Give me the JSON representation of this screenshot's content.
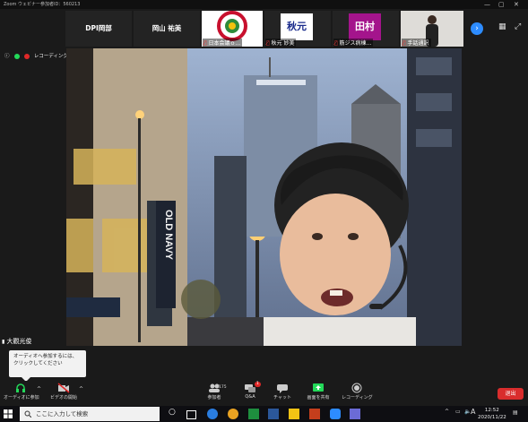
{
  "window": {
    "title": "Zoom ウェビナー参加者ID：560213"
  },
  "participants": [
    {
      "name": "DPI岡部",
      "caption": ""
    },
    {
      "name": "岡山 祐美",
      "caption": ""
    },
    {
      "name": "",
      "caption": "日本会議ｏ..."
    },
    {
      "name": "秋元",
      "caption": "秋元 妙美"
    },
    {
      "name": "田村",
      "caption": "筋ジス病棟..."
    },
    {
      "name": "",
      "caption": "手話通訳"
    }
  ],
  "recording": {
    "label": "レコーディングしています"
  },
  "speaker": {
    "name": "大觀光俊"
  },
  "audio_popup": {
    "text": "オーディオへ参加するには、クリックしてください"
  },
  "toolbar": {
    "audio": "オーディオに参加",
    "video": "ビデオの開始",
    "participants": "参加者",
    "participants_count": "175",
    "qa": "Q&A",
    "qa_badge": "1",
    "chat": "チャット",
    "share": "画面を共有",
    "record": "レコーディング",
    "leave": "退出"
  },
  "taskbar": {
    "search_placeholder": "ここに入力して検索",
    "time": "12:52",
    "date": "2020/11/22",
    "ime": "A"
  },
  "colors": {
    "accent": "#2d8cff",
    "leave": "#d92d2d",
    "green": "#23d959"
  }
}
